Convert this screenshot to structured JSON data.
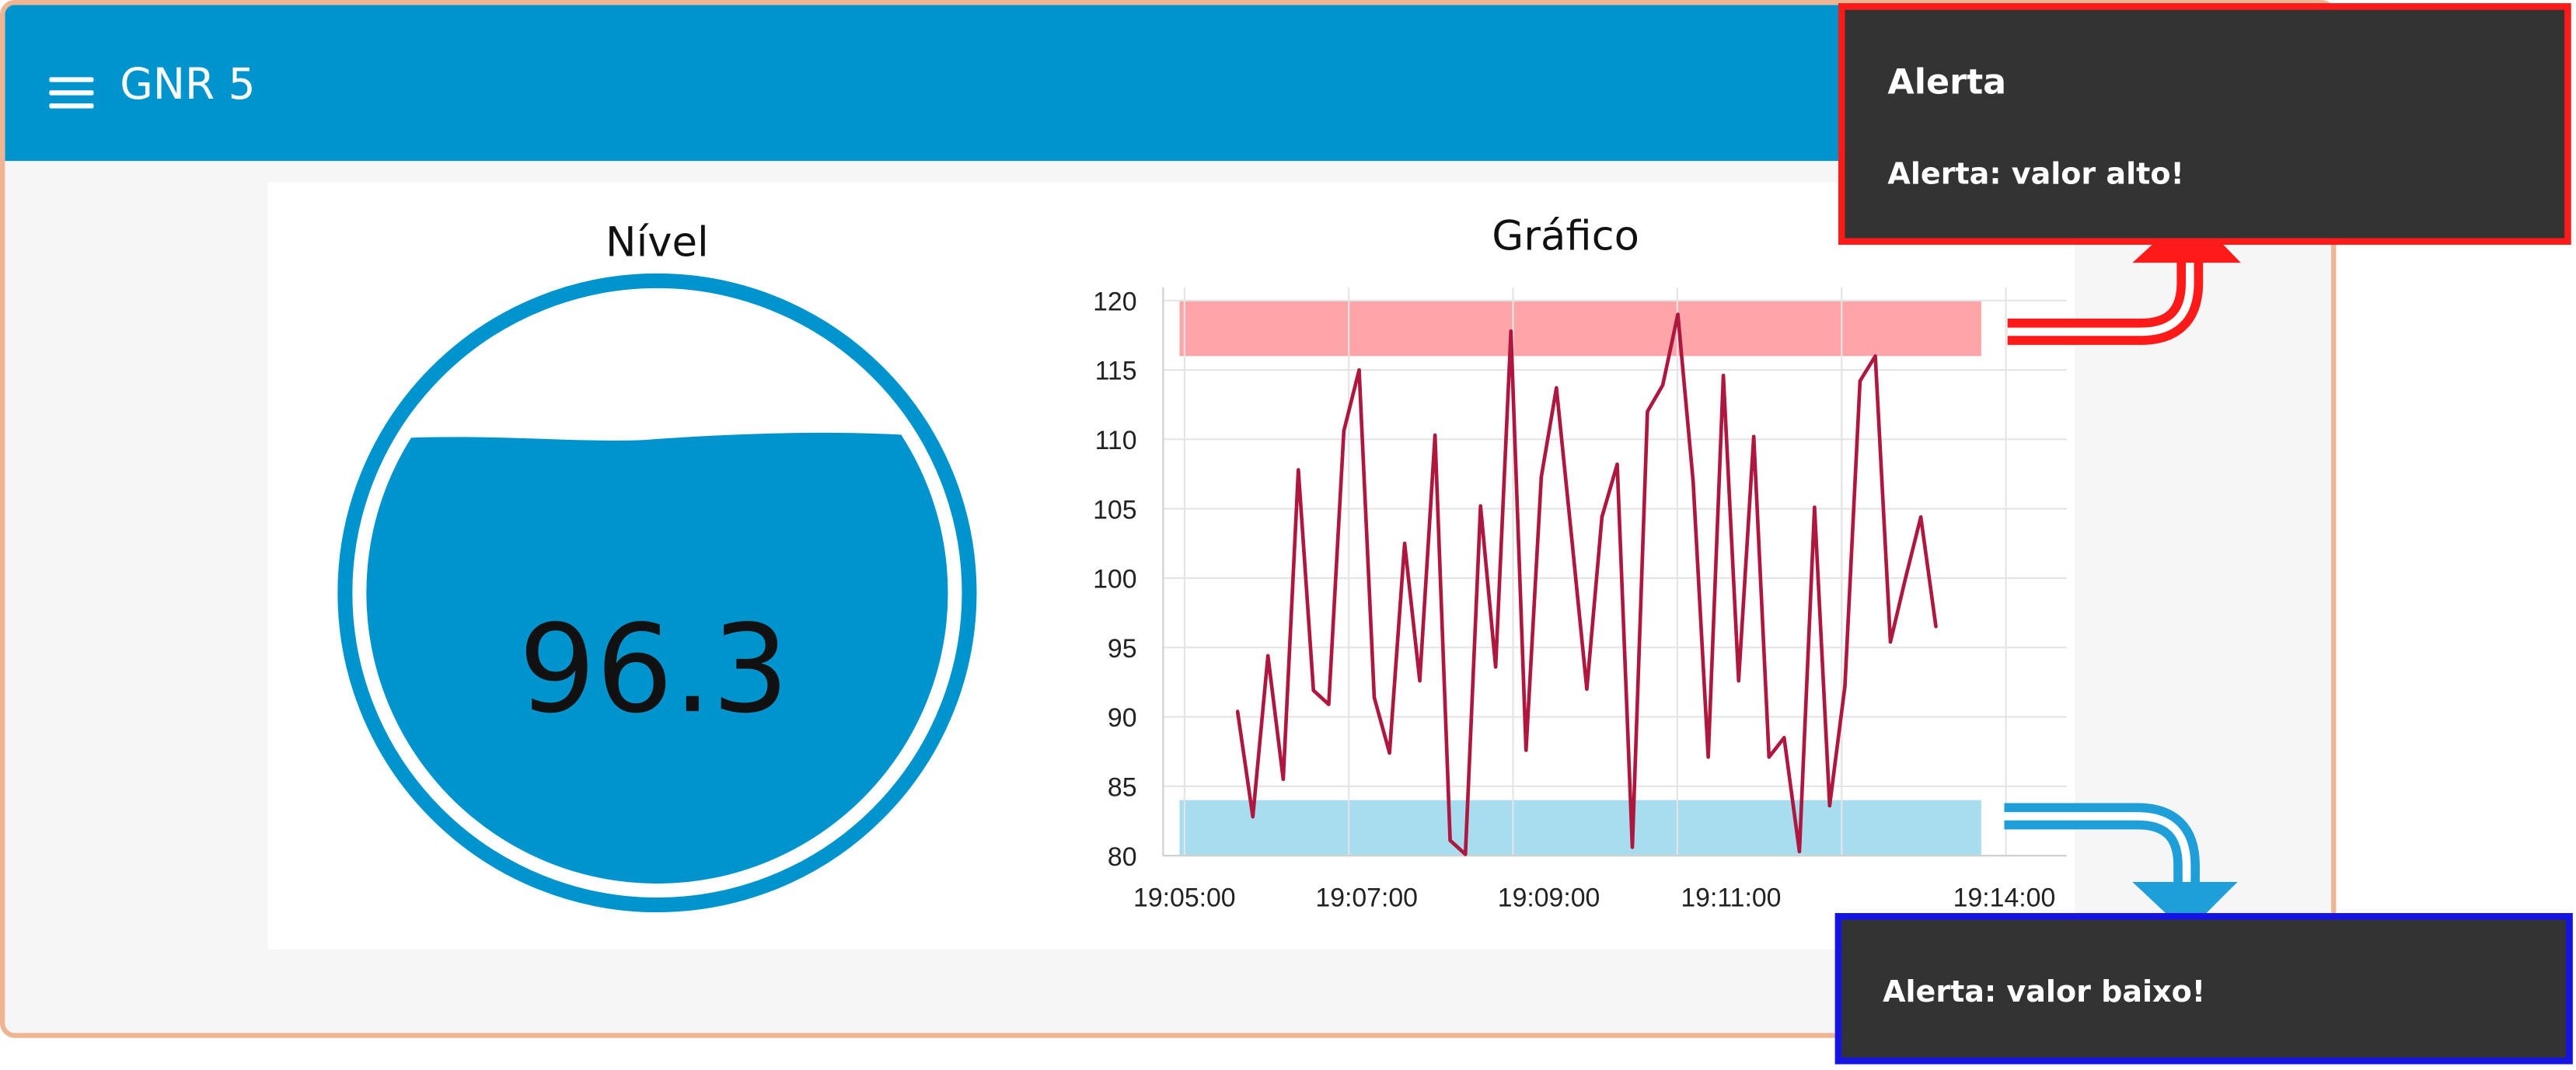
{
  "header": {
    "title": "GNR 5",
    "menu_icon": "menu-icon"
  },
  "gauge": {
    "title": "Nível",
    "value": "96.3",
    "level_fraction": 0.963,
    "color": "#0094ce"
  },
  "chart_data": {
    "type": "line",
    "title": "Gráfico",
    "xlabel": "",
    "ylabel": "",
    "ylim": [
      80,
      120
    ],
    "yticks": [
      "120",
      "115",
      "110",
      "105",
      "100",
      "95",
      "90",
      "85",
      "80"
    ],
    "xlim": [
      "19:05:00",
      "19:14:00"
    ],
    "xticks": [
      "19:05:00",
      "19:07:00",
      "19:09:00",
      "19:11:00",
      "19:14:00"
    ],
    "grid": true,
    "line_color": "#b0173f",
    "bands": [
      {
        "from": 116,
        "to": 120,
        "color": "#ffa5a8"
      },
      {
        "from": 80,
        "to": 84,
        "color": "#a8dcef"
      }
    ],
    "series": [
      {
        "x": [
          "19:05:35",
          "19:05:45",
          "19:05:55",
          "19:06:05",
          "19:06:15",
          "19:06:25",
          "19:06:35",
          "19:06:45",
          "19:06:55",
          "19:07:05",
          "19:07:15",
          "19:07:25",
          "19:07:35",
          "19:07:45",
          "19:07:55",
          "19:08:05",
          "19:08:15",
          "19:08:25",
          "19:08:35",
          "19:08:45",
          "19:08:55",
          "19:09:05",
          "19:09:15",
          "19:09:25",
          "19:09:35",
          "19:09:45",
          "19:09:55",
          "19:10:05",
          "19:10:15",
          "19:10:25",
          "19:10:35",
          "19:10:45",
          "19:10:55",
          "19:11:05",
          "19:11:15",
          "19:11:25",
          "19:11:35",
          "19:11:45",
          "19:11:55",
          "19:12:05",
          "19:12:15",
          "19:12:25",
          "19:12:35",
          "19:12:45",
          "19:12:55",
          "19:13:05",
          "19:13:15",
          "19:13:25"
        ],
        "values": [
          90.4,
          82.8,
          94.4,
          85.5,
          107.8,
          91.9,
          90.9,
          110.6,
          115.0,
          91.4,
          87.4,
          102.5,
          92.6,
          110.3,
          81.1,
          80.1,
          105.2,
          93.6,
          117.8,
          87.6,
          107.3,
          113.7,
          103.0,
          92.0,
          104.4,
          108.2,
          80.6,
          112.0,
          113.9,
          119.0,
          107.0,
          87.1,
          114.6,
          92.6,
          110.2,
          87.1,
          88.5,
          80.3,
          105.1,
          83.6,
          92.2,
          114.2,
          116.0,
          95.4,
          100.0,
          104.4,
          96.5,
          null
        ]
      }
    ]
  },
  "alerts": {
    "high": {
      "title": "Alerta",
      "message": "Alerta: valor alto!",
      "border_color": "#ff1a1a",
      "arrow_color": "#ff1a1a"
    },
    "low": {
      "message": "Alerta: valor baixo!",
      "border_color": "#1414e6",
      "arrow_color": "#1e9fd9"
    }
  }
}
